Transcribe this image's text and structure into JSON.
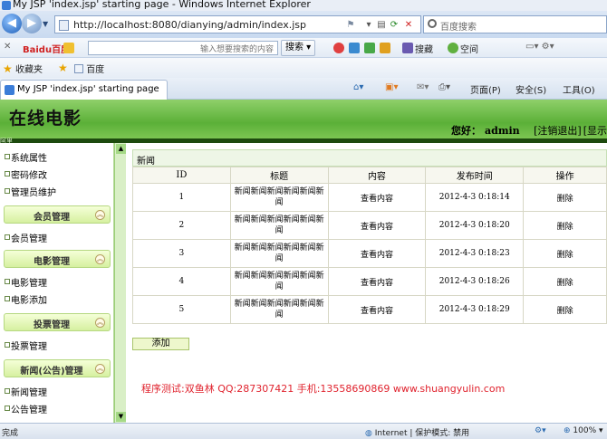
{
  "window": {
    "title": "My JSP 'index.jsp' starting page - Windows Internet Explorer"
  },
  "address": {
    "url": "http://localhost:8080/dianying/admin/index.jsp",
    "search_placeholder": "百度搜索"
  },
  "baidu_bar": {
    "logo": "Baidu百度",
    "input_placeholder": "输入想要搜索的内容",
    "search_label": "搜索",
    "collect_label": "搜藏",
    "space_label": "空间"
  },
  "favorites": {
    "label": "收藏夹",
    "item": "百度"
  },
  "tab": {
    "title": "My JSP 'index.jsp' starting page"
  },
  "commands": {
    "page": "页面(P)",
    "safety": "安全(S)",
    "tools": "工具(O)"
  },
  "site": {
    "title": "在线电影",
    "greeting": "您好：",
    "user": "admin",
    "logout": "[注销退出]",
    "home": "[显示主页]",
    "tiny_label": "阿里"
  },
  "sidebar": {
    "top_items": [
      "系统属性",
      "密码修改",
      "管理员维护"
    ],
    "groups": [
      {
        "title": "会员管理",
        "items": [
          "会员管理"
        ]
      },
      {
        "title": "电影管理",
        "items": [
          "电影管理",
          "电影添加"
        ]
      },
      {
        "title": "投票管理",
        "items": [
          "投票管理"
        ]
      },
      {
        "title": "新闻(公告)管理",
        "items": [
          "新闻管理",
          "公告管理"
        ]
      }
    ]
  },
  "main": {
    "section_title": "新闻",
    "columns": [
      "ID",
      "标题",
      "内容",
      "发布时间",
      "操作"
    ],
    "rows": [
      {
        "id": "1",
        "title": "新闻新闻新闻新闻新闻新闻",
        "content": "查看内容",
        "time": "2012-4-3 0:18:14",
        "action": "删除"
      },
      {
        "id": "2",
        "title": "新闻新闻新闻新闻新闻新闻",
        "content": "查看内容",
        "time": "2012-4-3 0:18:20",
        "action": "删除"
      },
      {
        "id": "3",
        "title": "新闻新闻新闻新闻新闻新闻",
        "content": "查看内容",
        "time": "2012-4-3 0:18:23",
        "action": "删除"
      },
      {
        "id": "4",
        "title": "新闻新闻新闻新闻新闻新闻",
        "content": "查看内容",
        "time": "2012-4-3 0:18:26",
        "action": "删除"
      },
      {
        "id": "5",
        "title": "新闻新闻新闻新闻新闻新闻",
        "content": "查看内容",
        "time": "2012-4-3 0:18:29",
        "action": "删除"
      }
    ],
    "add_label": "添加",
    "credit": "程序测试:双鱼林 QQ:287307421 手机:13558690869 www.shuangyulin.com"
  },
  "status": {
    "left": "完成",
    "zone": "Internet | 保护模式: 禁用",
    "zoom": "100%"
  },
  "colors": {
    "accent": "#5bb038",
    "credit": "#e0232e"
  }
}
